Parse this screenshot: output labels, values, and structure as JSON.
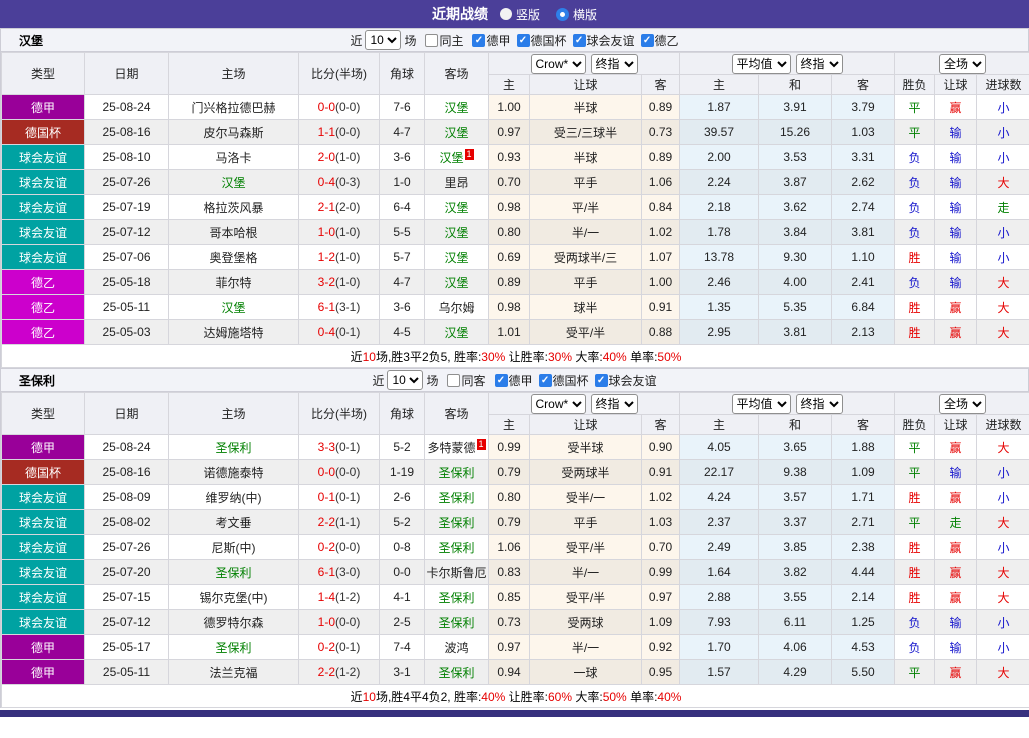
{
  "title_bar": {
    "title": "近期战绩",
    "vertical_label": "竖版",
    "horizontal_label": "横版",
    "selected": "横版"
  },
  "filter_labels": {
    "near": "近",
    "matches": "场"
  },
  "selects": {
    "near_count": "10",
    "company": "Crow*",
    "final_a": "终指",
    "average": "平均值",
    "final_b": "终指",
    "scope": "全场"
  },
  "labels": {
    "type": "类型",
    "date": "日期",
    "home": "主场",
    "score": "比分(半场)",
    "corner": "角球",
    "away": "客场",
    "odds_home": "主",
    "odds_handicap": "让球",
    "odds_away": "客",
    "avg_home": "主",
    "avg_draw": "和",
    "avg_away": "客",
    "result": "胜负",
    "handicap_result": "让球",
    "goals": "进球数"
  },
  "league_colors": {
    "德甲": "#990099",
    "德国杯": "#A62B22",
    "球会友谊": "#00A2A2",
    "德乙": "#CC00CC"
  },
  "colors": {
    "topbar": "#4B3F99",
    "bottombar": "#37307E",
    "win_red": "#E60000",
    "lose_blue": "#1414CC",
    "draw_green": "#008000",
    "focal_team_green": "#008000",
    "odds_col_bg": "#FDF6EC",
    "avg_col_bg": "#E9F3FA"
  },
  "sections": [
    {
      "team": "汉堡",
      "filter": {
        "same_label": "同主",
        "same_checked": false,
        "leagues": [
          {
            "label": "德甲",
            "checked": true
          },
          {
            "label": "德国杯",
            "checked": true
          },
          {
            "label": "球会友谊",
            "checked": true
          },
          {
            "label": "德乙",
            "checked": true
          }
        ]
      },
      "rows": [
        {
          "league": "德甲",
          "date": "25-08-24",
          "home": {
            "n": "门兴格拉德巴赫"
          },
          "score": "0-0",
          "half": "(0-0)",
          "corner": "7-6",
          "away": {
            "n": "汉堡",
            "f": 1
          },
          "o": [
            "1.00",
            "半球",
            "0.89"
          ],
          "a": [
            "1.87",
            "3.91",
            "3.79"
          ],
          "r": [
            "平",
            "g"
          ],
          "h": [
            "赢",
            "r"
          ],
          "g": [
            "小",
            "b"
          ]
        },
        {
          "league": "德国杯",
          "date": "25-08-16",
          "home": {
            "n": "皮尔马森斯"
          },
          "score": "1-1",
          "half": "(0-0)",
          "corner": "4-7",
          "away": {
            "n": "汉堡",
            "f": 1
          },
          "o": [
            "0.97",
            "受三/三球半",
            "0.73"
          ],
          "a": [
            "39.57",
            "15.26",
            "1.03"
          ],
          "r": [
            "平",
            "g"
          ],
          "h": [
            "输",
            "b"
          ],
          "g": [
            "小",
            "b"
          ]
        },
        {
          "league": "球会友谊",
          "date": "25-08-10",
          "home": {
            "n": "马洛卡"
          },
          "score": "2-0",
          "half": "(1-0)",
          "corner": "3-6",
          "away": {
            "n": "汉堡",
            "f": 1,
            "b": "1"
          },
          "o": [
            "0.93",
            "半球",
            "0.89"
          ],
          "a": [
            "2.00",
            "3.53",
            "3.31"
          ],
          "r": [
            "负",
            "b"
          ],
          "h": [
            "输",
            "b"
          ],
          "g": [
            "小",
            "b"
          ]
        },
        {
          "league": "球会友谊",
          "date": "25-07-26",
          "home": {
            "n": "汉堡",
            "f": 1
          },
          "score": "0-4",
          "half": "(0-3)",
          "corner": "1-0",
          "away": {
            "n": "里昂"
          },
          "o": [
            "0.70",
            "平手",
            "1.06"
          ],
          "a": [
            "2.24",
            "3.87",
            "2.62"
          ],
          "r": [
            "负",
            "b"
          ],
          "h": [
            "输",
            "b"
          ],
          "g": [
            "大",
            "r"
          ]
        },
        {
          "league": "球会友谊",
          "date": "25-07-19",
          "home": {
            "n": "格拉茨风暴"
          },
          "score": "2-1",
          "half": "(2-0)",
          "corner": "6-4",
          "away": {
            "n": "汉堡",
            "f": 1
          },
          "o": [
            "0.98",
            "平/半",
            "0.84"
          ],
          "a": [
            "2.18",
            "3.62",
            "2.74"
          ],
          "r": [
            "负",
            "b"
          ],
          "h": [
            "输",
            "b"
          ],
          "g": [
            "走",
            "g"
          ]
        },
        {
          "league": "球会友谊",
          "date": "25-07-12",
          "home": {
            "n": "哥本哈根"
          },
          "score": "1-0",
          "half": "(1-0)",
          "corner": "5-5",
          "away": {
            "n": "汉堡",
            "f": 1
          },
          "o": [
            "0.80",
            "半/一",
            "1.02"
          ],
          "a": [
            "1.78",
            "3.84",
            "3.81"
          ],
          "r": [
            "负",
            "b"
          ],
          "h": [
            "输",
            "b"
          ],
          "g": [
            "小",
            "b"
          ]
        },
        {
          "league": "球会友谊",
          "date": "25-07-06",
          "home": {
            "n": "奥登堡格"
          },
          "score": "1-2",
          "half": "(1-0)",
          "corner": "5-7",
          "away": {
            "n": "汉堡",
            "f": 1
          },
          "o": [
            "0.69",
            "受两球半/三",
            "1.07"
          ],
          "a": [
            "13.78",
            "9.30",
            "1.10"
          ],
          "r": [
            "胜",
            "r"
          ],
          "h": [
            "输",
            "b"
          ],
          "g": [
            "小",
            "b"
          ]
        },
        {
          "league": "德乙",
          "date": "25-05-18",
          "home": {
            "n": "菲尔特"
          },
          "score": "3-2",
          "half": "(1-0)",
          "corner": "4-7",
          "away": {
            "n": "汉堡",
            "f": 1
          },
          "o": [
            "0.89",
            "平手",
            "1.00"
          ],
          "a": [
            "2.46",
            "4.00",
            "2.41"
          ],
          "r": [
            "负",
            "b"
          ],
          "h": [
            "输",
            "b"
          ],
          "g": [
            "大",
            "r"
          ]
        },
        {
          "league": "德乙",
          "date": "25-05-11",
          "home": {
            "n": "汉堡",
            "f": 1
          },
          "score": "6-1",
          "half": "(3-1)",
          "corner": "3-6",
          "away": {
            "n": "乌尔姆"
          },
          "o": [
            "0.98",
            "球半",
            "0.91"
          ],
          "a": [
            "1.35",
            "5.35",
            "6.84"
          ],
          "r": [
            "胜",
            "r"
          ],
          "h": [
            "赢",
            "r"
          ],
          "g": [
            "大",
            "r"
          ]
        },
        {
          "league": "德乙",
          "date": "25-05-03",
          "home": {
            "n": "达姆施塔特"
          },
          "score": "0-4",
          "half": "(0-1)",
          "corner": "4-5",
          "away": {
            "n": "汉堡",
            "f": 1
          },
          "o": [
            "1.01",
            "受平/半",
            "0.88"
          ],
          "a": [
            "2.95",
            "3.81",
            "2.13"
          ],
          "r": [
            "胜",
            "r"
          ],
          "h": [
            "赢",
            "r"
          ],
          "g": [
            "大",
            "r"
          ]
        }
      ],
      "summary": [
        [
          "近",
          0
        ],
        [
          "10",
          1
        ],
        [
          "场,胜3平2负5, 胜率:",
          0
        ],
        [
          "30%",
          1
        ],
        [
          " 让胜率:",
          0
        ],
        [
          "30%",
          1
        ],
        [
          " 大率:",
          0
        ],
        [
          "40%",
          1
        ],
        [
          " 单率:",
          0
        ],
        [
          "50%",
          1
        ]
      ]
    },
    {
      "team": "圣保利",
      "filter": {
        "same_label": "同客",
        "same_checked": false,
        "leagues": [
          {
            "label": "德甲",
            "checked": true
          },
          {
            "label": "德国杯",
            "checked": true
          },
          {
            "label": "球会友谊",
            "checked": true
          }
        ]
      },
      "rows": [
        {
          "league": "德甲",
          "date": "25-08-24",
          "home": {
            "n": "圣保利",
            "f": 1
          },
          "score": "3-3",
          "half": "(0-1)",
          "corner": "5-2",
          "away": {
            "n": "多特蒙德",
            "b": "1"
          },
          "o": [
            "0.99",
            "受半球",
            "0.90"
          ],
          "a": [
            "4.05",
            "3.65",
            "1.88"
          ],
          "r": [
            "平",
            "g"
          ],
          "h": [
            "赢",
            "r"
          ],
          "g": [
            "大",
            "r"
          ]
        },
        {
          "league": "德国杯",
          "date": "25-08-16",
          "home": {
            "n": "诺德施泰特"
          },
          "score": "0-0",
          "half": "(0-0)",
          "corner": "1-19",
          "away": {
            "n": "圣保利",
            "f": 1
          },
          "o": [
            "0.79",
            "受两球半",
            "0.91"
          ],
          "a": [
            "22.17",
            "9.38",
            "1.09"
          ],
          "r": [
            "平",
            "g"
          ],
          "h": [
            "输",
            "b"
          ],
          "g": [
            "小",
            "b"
          ]
        },
        {
          "league": "球会友谊",
          "date": "25-08-09",
          "home": {
            "n": "维罗纳(中)"
          },
          "score": "0-1",
          "half": "(0-1)",
          "corner": "2-6",
          "away": {
            "n": "圣保利",
            "f": 1
          },
          "o": [
            "0.80",
            "受半/一",
            "1.02"
          ],
          "a": [
            "4.24",
            "3.57",
            "1.71"
          ],
          "r": [
            "胜",
            "r"
          ],
          "h": [
            "赢",
            "r"
          ],
          "g": [
            "小",
            "b"
          ]
        },
        {
          "league": "球会友谊",
          "date": "25-08-02",
          "home": {
            "n": "考文垂"
          },
          "score": "2-2",
          "half": "(1-1)",
          "corner": "5-2",
          "away": {
            "n": "圣保利",
            "f": 1
          },
          "o": [
            "0.79",
            "平手",
            "1.03"
          ],
          "a": [
            "2.37",
            "3.37",
            "2.71"
          ],
          "r": [
            "平",
            "g"
          ],
          "h": [
            "走",
            "g"
          ],
          "g": [
            "大",
            "r"
          ]
        },
        {
          "league": "球会友谊",
          "date": "25-07-26",
          "home": {
            "n": "尼斯(中)"
          },
          "score": "0-2",
          "half": "(0-0)",
          "corner": "0-8",
          "away": {
            "n": "圣保利",
            "f": 1
          },
          "o": [
            "1.06",
            "受平/半",
            "0.70"
          ],
          "a": [
            "2.49",
            "3.85",
            "2.38"
          ],
          "r": [
            "胜",
            "r"
          ],
          "h": [
            "赢",
            "r"
          ],
          "g": [
            "小",
            "b"
          ]
        },
        {
          "league": "球会友谊",
          "date": "25-07-20",
          "home": {
            "n": "圣保利",
            "f": 1
          },
          "score": "6-1",
          "half": "(3-0)",
          "corner": "0-0",
          "away": {
            "n": "卡尔斯鲁厄"
          },
          "o": [
            "0.83",
            "半/一",
            "0.99"
          ],
          "a": [
            "1.64",
            "3.82",
            "4.44"
          ],
          "r": [
            "胜",
            "r"
          ],
          "h": [
            "赢",
            "r"
          ],
          "g": [
            "大",
            "r"
          ]
        },
        {
          "league": "球会友谊",
          "date": "25-07-15",
          "home": {
            "n": "锡尔克堡(中)"
          },
          "score": "1-4",
          "half": "(1-2)",
          "corner": "4-1",
          "away": {
            "n": "圣保利",
            "f": 1
          },
          "o": [
            "0.85",
            "受平/半",
            "0.97"
          ],
          "a": [
            "2.88",
            "3.55",
            "2.14"
          ],
          "r": [
            "胜",
            "r"
          ],
          "h": [
            "赢",
            "r"
          ],
          "g": [
            "大",
            "r"
          ]
        },
        {
          "league": "球会友谊",
          "date": "25-07-12",
          "home": {
            "n": "德罗特尔森"
          },
          "score": "1-0",
          "half": "(0-0)",
          "corner": "2-5",
          "away": {
            "n": "圣保利",
            "f": 1
          },
          "o": [
            "0.73",
            "受两球",
            "1.09"
          ],
          "a": [
            "7.93",
            "6.11",
            "1.25"
          ],
          "r": [
            "负",
            "b"
          ],
          "h": [
            "输",
            "b"
          ],
          "g": [
            "小",
            "b"
          ]
        },
        {
          "league": "德甲",
          "date": "25-05-17",
          "home": {
            "n": "圣保利",
            "f": 1
          },
          "score": "0-2",
          "half": "(0-1)",
          "corner": "7-4",
          "away": {
            "n": "波鸿"
          },
          "o": [
            "0.97",
            "半/一",
            "0.92"
          ],
          "a": [
            "1.70",
            "4.06",
            "4.53"
          ],
          "r": [
            "负",
            "b"
          ],
          "h": [
            "输",
            "b"
          ],
          "g": [
            "小",
            "b"
          ]
        },
        {
          "league": "德甲",
          "date": "25-05-11",
          "home": {
            "n": "法兰克福"
          },
          "score": "2-2",
          "half": "(1-2)",
          "corner": "3-1",
          "away": {
            "n": "圣保利",
            "f": 1
          },
          "o": [
            "0.94",
            "一球",
            "0.95"
          ],
          "a": [
            "1.57",
            "4.29",
            "5.50"
          ],
          "r": [
            "平",
            "g"
          ],
          "h": [
            "赢",
            "r"
          ],
          "g": [
            "大",
            "r"
          ]
        }
      ],
      "summary": [
        [
          "近",
          0
        ],
        [
          "10",
          1
        ],
        [
          "场,胜4平4负2, 胜率:",
          0
        ],
        [
          "40%",
          1
        ],
        [
          " 让胜率:",
          0
        ],
        [
          "60%",
          1
        ],
        [
          " 大率:",
          0
        ],
        [
          "50%",
          1
        ],
        [
          " 单率:",
          0
        ],
        [
          "40%",
          1
        ]
      ]
    }
  ]
}
